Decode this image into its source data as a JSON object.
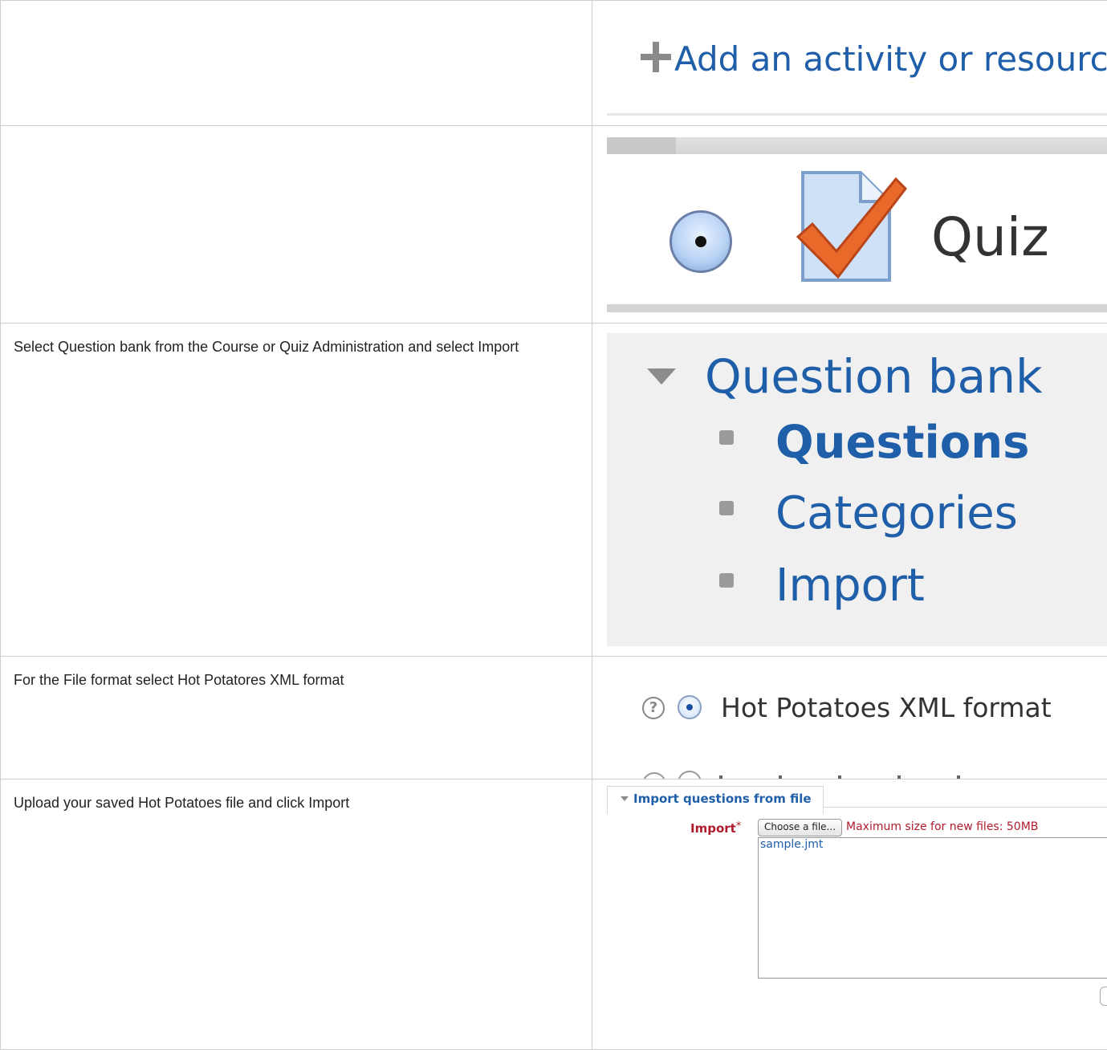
{
  "rows": [
    {
      "instruction": "",
      "add_activity_label": "Add an activity or resource"
    },
    {
      "instruction": "",
      "quiz_label": "Quiz"
    },
    {
      "instruction": "Select Question bank from the Course or Quiz Administration and select Import",
      "question_bank": {
        "title": "Question bank",
        "items": [
          "Questions",
          "Categories",
          "Import"
        ]
      }
    },
    {
      "instruction": "For the File format select Hot Potatores XML format",
      "format_option": "Hot Potatoes XML format"
    },
    {
      "instruction": "Upload your saved Hot Potatoes file and click Import",
      "import_form": {
        "legend": "Import questions from file",
        "field_label": "Import",
        "required_marker": "*",
        "choose_button": "Choose a file...",
        "max_size": "Maximum size for new files: 50MB",
        "file_name": "sample.jmt"
      }
    }
  ],
  "colors": {
    "link_blue": "#1f5ea8",
    "required_red": "#b01c2e",
    "panel_grey": "#f0f0f0",
    "checkmark_orange": "#e8692a"
  },
  "icons": [
    "plus-icon",
    "radio-selected-icon",
    "quiz-checkmark-icon",
    "expand-triangle-icon",
    "bullet-icon",
    "help-icon"
  ]
}
